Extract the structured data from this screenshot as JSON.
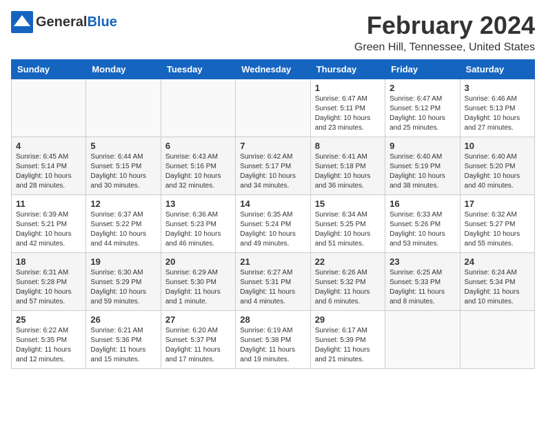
{
  "logo": {
    "general": "General",
    "blue": "Blue"
  },
  "header": {
    "month": "February 2024",
    "location": "Green Hill, Tennessee, United States"
  },
  "weekdays": [
    "Sunday",
    "Monday",
    "Tuesday",
    "Wednesday",
    "Thursday",
    "Friday",
    "Saturday"
  ],
  "weeks": [
    [
      {
        "day": "",
        "info": ""
      },
      {
        "day": "",
        "info": ""
      },
      {
        "day": "",
        "info": ""
      },
      {
        "day": "",
        "info": ""
      },
      {
        "day": "1",
        "info": "Sunrise: 6:47 AM\nSunset: 5:11 PM\nDaylight: 10 hours\nand 23 minutes."
      },
      {
        "day": "2",
        "info": "Sunrise: 6:47 AM\nSunset: 5:12 PM\nDaylight: 10 hours\nand 25 minutes."
      },
      {
        "day": "3",
        "info": "Sunrise: 6:46 AM\nSunset: 5:13 PM\nDaylight: 10 hours\nand 27 minutes."
      }
    ],
    [
      {
        "day": "4",
        "info": "Sunrise: 6:45 AM\nSunset: 5:14 PM\nDaylight: 10 hours\nand 28 minutes."
      },
      {
        "day": "5",
        "info": "Sunrise: 6:44 AM\nSunset: 5:15 PM\nDaylight: 10 hours\nand 30 minutes."
      },
      {
        "day": "6",
        "info": "Sunrise: 6:43 AM\nSunset: 5:16 PM\nDaylight: 10 hours\nand 32 minutes."
      },
      {
        "day": "7",
        "info": "Sunrise: 6:42 AM\nSunset: 5:17 PM\nDaylight: 10 hours\nand 34 minutes."
      },
      {
        "day": "8",
        "info": "Sunrise: 6:41 AM\nSunset: 5:18 PM\nDaylight: 10 hours\nand 36 minutes."
      },
      {
        "day": "9",
        "info": "Sunrise: 6:40 AM\nSunset: 5:19 PM\nDaylight: 10 hours\nand 38 minutes."
      },
      {
        "day": "10",
        "info": "Sunrise: 6:40 AM\nSunset: 5:20 PM\nDaylight: 10 hours\nand 40 minutes."
      }
    ],
    [
      {
        "day": "11",
        "info": "Sunrise: 6:39 AM\nSunset: 5:21 PM\nDaylight: 10 hours\nand 42 minutes."
      },
      {
        "day": "12",
        "info": "Sunrise: 6:37 AM\nSunset: 5:22 PM\nDaylight: 10 hours\nand 44 minutes."
      },
      {
        "day": "13",
        "info": "Sunrise: 6:36 AM\nSunset: 5:23 PM\nDaylight: 10 hours\nand 46 minutes."
      },
      {
        "day": "14",
        "info": "Sunrise: 6:35 AM\nSunset: 5:24 PM\nDaylight: 10 hours\nand 49 minutes."
      },
      {
        "day": "15",
        "info": "Sunrise: 6:34 AM\nSunset: 5:25 PM\nDaylight: 10 hours\nand 51 minutes."
      },
      {
        "day": "16",
        "info": "Sunrise: 6:33 AM\nSunset: 5:26 PM\nDaylight: 10 hours\nand 53 minutes."
      },
      {
        "day": "17",
        "info": "Sunrise: 6:32 AM\nSunset: 5:27 PM\nDaylight: 10 hours\nand 55 minutes."
      }
    ],
    [
      {
        "day": "18",
        "info": "Sunrise: 6:31 AM\nSunset: 5:28 PM\nDaylight: 10 hours\nand 57 minutes."
      },
      {
        "day": "19",
        "info": "Sunrise: 6:30 AM\nSunset: 5:29 PM\nDaylight: 10 hours\nand 59 minutes."
      },
      {
        "day": "20",
        "info": "Sunrise: 6:29 AM\nSunset: 5:30 PM\nDaylight: 11 hours\nand 1 minute."
      },
      {
        "day": "21",
        "info": "Sunrise: 6:27 AM\nSunset: 5:31 PM\nDaylight: 11 hours\nand 4 minutes."
      },
      {
        "day": "22",
        "info": "Sunrise: 6:26 AM\nSunset: 5:32 PM\nDaylight: 11 hours\nand 6 minutes."
      },
      {
        "day": "23",
        "info": "Sunrise: 6:25 AM\nSunset: 5:33 PM\nDaylight: 11 hours\nand 8 minutes."
      },
      {
        "day": "24",
        "info": "Sunrise: 6:24 AM\nSunset: 5:34 PM\nDaylight: 11 hours\nand 10 minutes."
      }
    ],
    [
      {
        "day": "25",
        "info": "Sunrise: 6:22 AM\nSunset: 5:35 PM\nDaylight: 11 hours\nand 12 minutes."
      },
      {
        "day": "26",
        "info": "Sunrise: 6:21 AM\nSunset: 5:36 PM\nDaylight: 11 hours\nand 15 minutes."
      },
      {
        "day": "27",
        "info": "Sunrise: 6:20 AM\nSunset: 5:37 PM\nDaylight: 11 hours\nand 17 minutes."
      },
      {
        "day": "28",
        "info": "Sunrise: 6:19 AM\nSunset: 5:38 PM\nDaylight: 11 hours\nand 19 minutes."
      },
      {
        "day": "29",
        "info": "Sunrise: 6:17 AM\nSunset: 5:39 PM\nDaylight: 11 hours\nand 21 minutes."
      },
      {
        "day": "",
        "info": ""
      },
      {
        "day": "",
        "info": ""
      }
    ]
  ]
}
